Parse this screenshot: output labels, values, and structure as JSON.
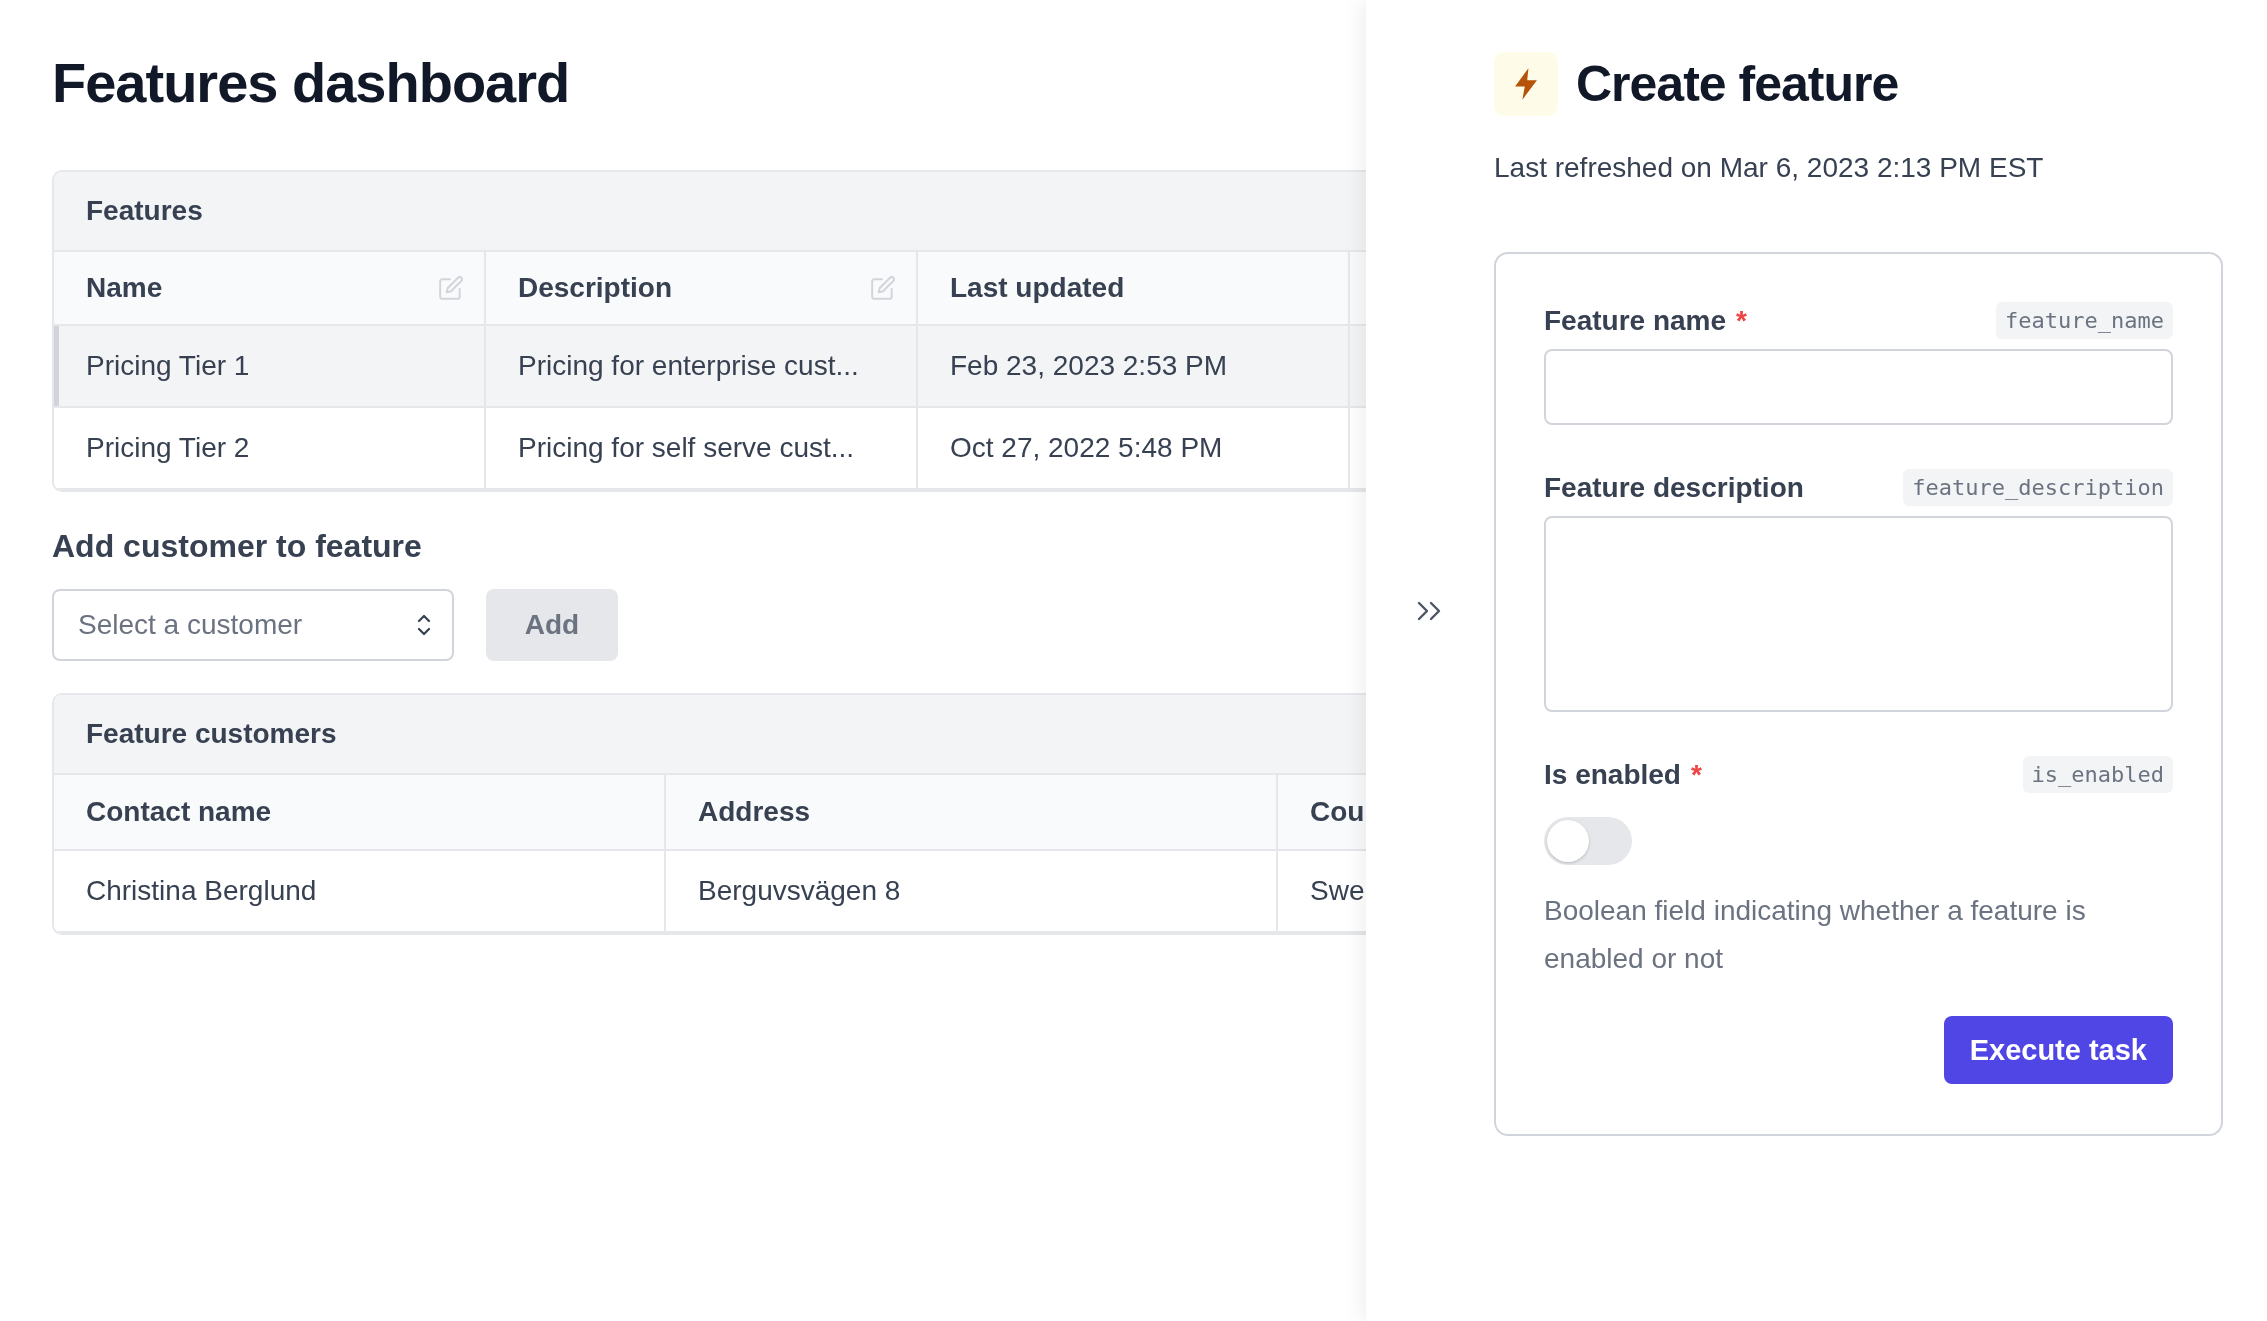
{
  "page": {
    "title": "Features dashboard"
  },
  "features_table": {
    "title": "Features",
    "columns": [
      {
        "label": "Name",
        "editable": true
      },
      {
        "label": "Description",
        "editable": true
      },
      {
        "label": "Last updated",
        "editable": false
      }
    ],
    "rows": [
      {
        "selected": true,
        "cells": [
          "Pricing Tier 1",
          "Pricing for enterprise cust...",
          "Feb 23, 2023 2:53 PM"
        ]
      },
      {
        "selected": false,
        "cells": [
          "Pricing Tier 2",
          "Pricing for self serve cust...",
          "Oct 27, 2022 5:48 PM"
        ]
      }
    ]
  },
  "add_customer": {
    "heading": "Add customer to feature",
    "select": {
      "placeholder": "Select a customer"
    },
    "button": {
      "label": "Add",
      "disabled": true
    }
  },
  "customers_table": {
    "title": "Feature customers",
    "columns": [
      "Contact name",
      "Address",
      "Cou"
    ],
    "rows": [
      {
        "cells": [
          "Christina Berglund",
          "Berguvsvägen 8",
          "Swe"
        ]
      }
    ]
  },
  "panel": {
    "title": "Create feature",
    "subtitle": "Last refreshed on Mar 6, 2023 2:13 PM EST",
    "fields": [
      {
        "kind": "text",
        "label": "Feature name",
        "required_mark": "*",
        "key": "feature_name"
      },
      {
        "kind": "textarea",
        "label": "Feature description",
        "key": "feature_description"
      },
      {
        "kind": "toggle",
        "label": "Is enabled",
        "required_mark": "*",
        "key": "is_enabled",
        "on": false,
        "help": "Boolean field indicating whether a feature is enabled or not"
      }
    ],
    "submit": "Execute task"
  }
}
